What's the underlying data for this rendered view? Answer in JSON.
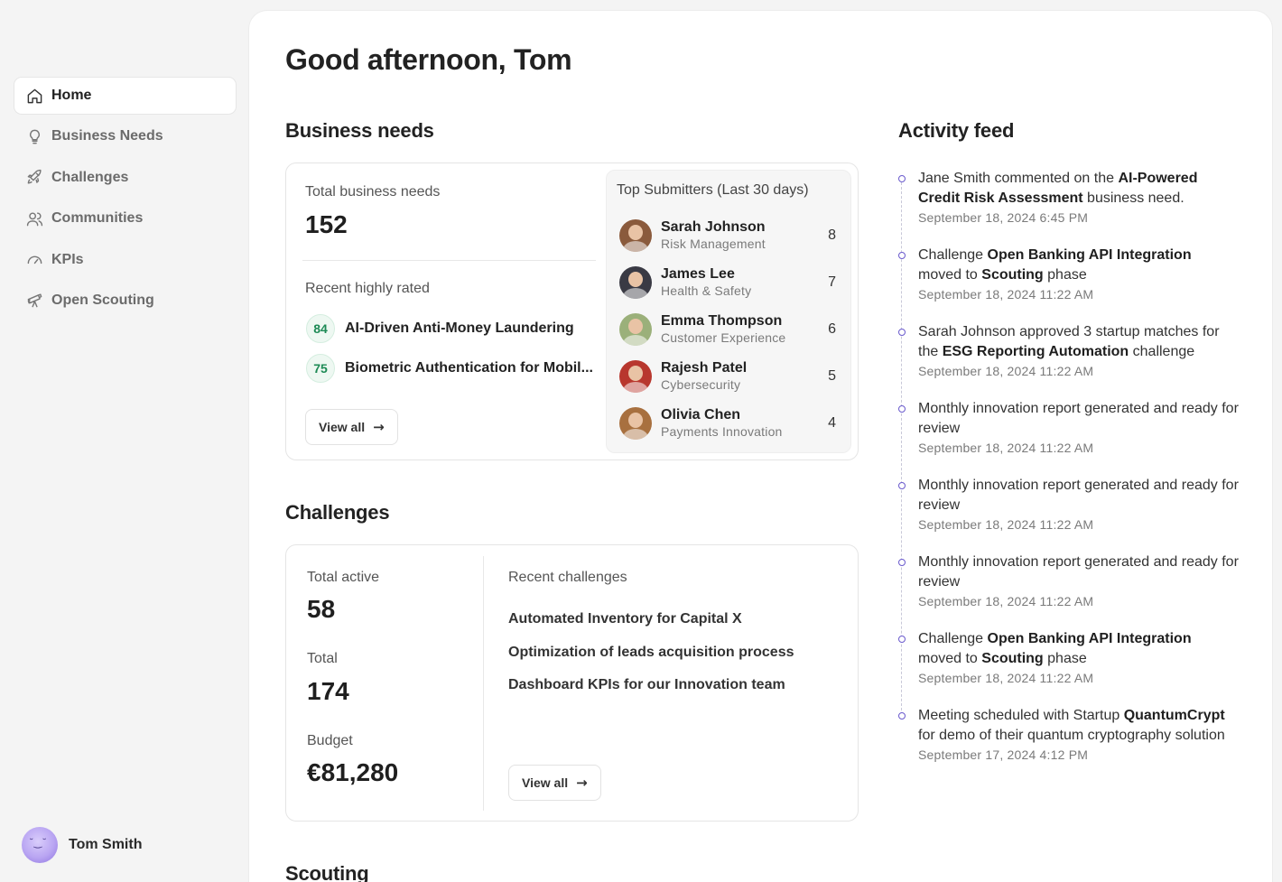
{
  "sidebar": {
    "items": [
      {
        "label": "Home",
        "icon": "home-icon"
      },
      {
        "label": "Business Needs",
        "icon": "lightbulb-icon"
      },
      {
        "label": "Challenges",
        "icon": "rocket-icon"
      },
      {
        "label": "Communities",
        "icon": "users-icon"
      },
      {
        "label": "KPIs",
        "icon": "gauge-icon"
      },
      {
        "label": "Open Scouting",
        "icon": "telescope-icon"
      }
    ],
    "user_name": "Tom Smith"
  },
  "greeting": "Good afternoon, Tom",
  "business_needs": {
    "title": "Business needs",
    "total_label": "Total business needs",
    "total_value": "152",
    "recent_label": "Recent highly rated",
    "rated": [
      {
        "score": "84",
        "name": "AI-Driven Anti-Money Laundering"
      },
      {
        "score": "75",
        "name": "Biometric Authentication for Mobil..."
      }
    ],
    "view_all": "View all",
    "submitters_title": "Top Submitters (Last 30 days)",
    "submitters": [
      {
        "name": "Sarah Johnson",
        "dept": "Risk Management",
        "count": "8"
      },
      {
        "name": "James Lee",
        "dept": "Health & Safety",
        "count": "7"
      },
      {
        "name": "Emma Thompson",
        "dept": "Customer Experience",
        "count": "6"
      },
      {
        "name": "Rajesh Patel",
        "dept": "Cybersecurity",
        "count": "5"
      },
      {
        "name": "Olivia Chen",
        "dept": "Payments Innovation",
        "count": "4"
      }
    ]
  },
  "challenges": {
    "title": "Challenges",
    "active_label": "Total active",
    "active_value": "58",
    "total_label": "Total",
    "total_value": "174",
    "budget_label": "Budget",
    "budget_value": "€81,280",
    "recent_label": "Recent challenges",
    "recent": [
      "Automated Inventory for Capital X",
      "Optimization of leads acquisition process",
      "Dashboard KPIs for our Innovation team"
    ],
    "view_all": "View all"
  },
  "scouting": {
    "title": "Scouting"
  },
  "activity": {
    "title": "Activity feed",
    "items": [
      {
        "pre": "Jane Smith commented on the ",
        "bold": "AI-Powered Credit Risk Assessment",
        "post": " business need.",
        "time": "September 18, 2024 6:45 PM"
      },
      {
        "pre": "Challenge ",
        "bold": "Open Banking API Integration",
        "mid": " moved to ",
        "bold2": "Scouting",
        "post": " phase",
        "time": "September 18, 2024 11:22 AM"
      },
      {
        "pre": "Sarah Johnson approved 3 startup matches for the ",
        "bold": "ESG Reporting Automation",
        "post": " challenge",
        "time": "September 18, 2024 11:22 AM"
      },
      {
        "pre": "Monthly innovation report generated and ready for review",
        "time": "September 18, 2024 11:22 AM"
      },
      {
        "pre": "Monthly innovation report generated and ready for review",
        "time": "September 18, 2024 11:22 AM"
      },
      {
        "pre": "Monthly innovation report generated and ready for review",
        "time": "September 18, 2024 11:22 AM"
      },
      {
        "pre": "Challenge ",
        "bold": "Open Banking API Integration",
        "mid": " moved to ",
        "bold2": "Scouting",
        "post": " phase",
        "time": "September 18, 2024 11:22 AM"
      },
      {
        "pre": "Meeting scheduled with Startup ",
        "bold": "QuantumCrypt",
        "post": " for demo of their quantum cryptography solution",
        "time": "September 17, 2024 4:12 PM"
      }
    ]
  },
  "colors": {
    "accent": "#6a5acd",
    "score_green": "#1d8a55"
  }
}
